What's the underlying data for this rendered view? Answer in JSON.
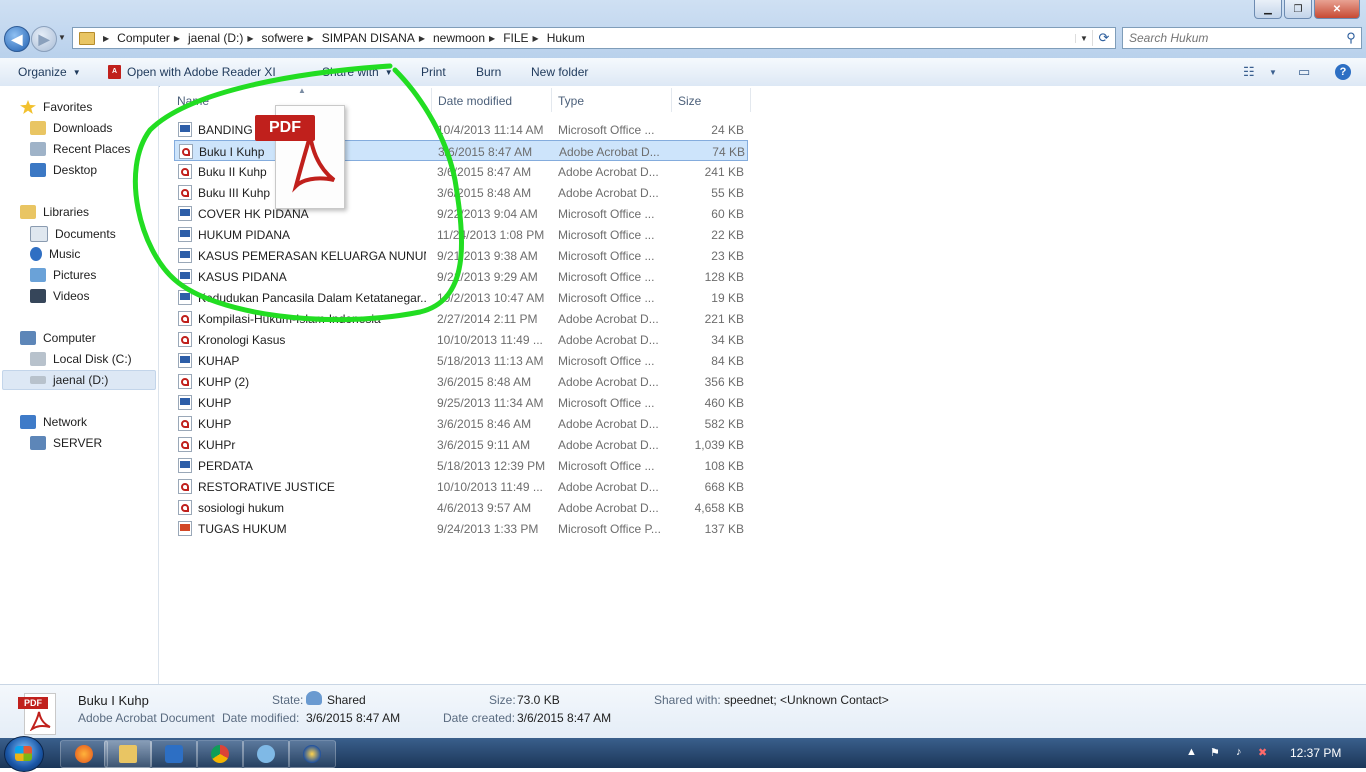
{
  "window": {
    "min_label": "▁",
    "max_label": "❐",
    "close_label": "✕"
  },
  "address": {
    "crumbs": [
      "Computer",
      "jaenal (D:)",
      "sofwere",
      "SIMPAN DISANA",
      "newmoon",
      "FILE",
      "Hukum"
    ]
  },
  "search": {
    "placeholder": "Search Hukum"
  },
  "toolbar": {
    "organize": "Organize",
    "open_with": "Open with Adobe Reader XI",
    "share_with": "Share with",
    "print": "Print",
    "burn": "Burn",
    "new_folder": "New folder"
  },
  "nav": {
    "favorites": "Favorites",
    "downloads": "Downloads",
    "recent": "Recent Places",
    "desktop": "Desktop",
    "libraries": "Libraries",
    "documents": "Documents",
    "music": "Music",
    "pictures": "Pictures",
    "videos": "Videos",
    "computer": "Computer",
    "local_disk": "Local Disk (C:)",
    "jaenal": "jaenal (D:)",
    "network": "Network",
    "server": "SERVER"
  },
  "columns": {
    "name": "Name",
    "date": "Date modified",
    "type": "Type",
    "size": "Size"
  },
  "files": [
    {
      "name": "BANDING DAN KASASI",
      "date": "10/4/2013 11:14 AM",
      "type": "Microsoft Office ...",
      "size": "24 KB",
      "icon": "doc"
    },
    {
      "name": "Buku I Kuhp",
      "date": "3/6/2015 8:47 AM",
      "type": "Adobe Acrobat D...",
      "size": "74 KB",
      "icon": "pdf",
      "selected": true
    },
    {
      "name": "Buku II Kuhp",
      "date": "3/6/2015 8:47 AM",
      "type": "Adobe Acrobat D...",
      "size": "241 KB",
      "icon": "pdf"
    },
    {
      "name": "Buku III Kuhp",
      "date": "3/6/2015 8:48 AM",
      "type": "Adobe Acrobat D...",
      "size": "55 KB",
      "icon": "pdf"
    },
    {
      "name": "COVER HK PIDANA",
      "date": "9/22/2013 9:04 AM",
      "type": "Microsoft Office ...",
      "size": "60 KB",
      "icon": "doc"
    },
    {
      "name": "HUKUM PIDANA",
      "date": "11/24/2013 1:08 PM",
      "type": "Microsoft Office ...",
      "size": "22 KB",
      "icon": "doc"
    },
    {
      "name": "KASUS  PEMERASAN KELUARGA NUNUNG",
      "date": "9/21/2013 9:38 AM",
      "type": "Microsoft Office ...",
      "size": "23 KB",
      "icon": "doc"
    },
    {
      "name": "KASUS PIDANA",
      "date": "9/21/2013 9:29 AM",
      "type": "Microsoft Office ...",
      "size": "128 KB",
      "icon": "doc"
    },
    {
      "name": "Kedudukan Pancasila Dalam Ketatanegar...",
      "date": "10/2/2013 10:47 AM",
      "type": "Microsoft Office ...",
      "size": "19 KB",
      "icon": "doc"
    },
    {
      "name": "Kompilasi-Hukum-Islam-Indonesia",
      "date": "2/27/2014 2:11 PM",
      "type": "Adobe Acrobat D...",
      "size": "221 KB",
      "icon": "pdf"
    },
    {
      "name": "Kronologi Kasus",
      "date": "10/10/2013 11:49 ...",
      "type": "Adobe Acrobat D...",
      "size": "34 KB",
      "icon": "pdf"
    },
    {
      "name": "KUHAP",
      "date": "5/18/2013 11:13 AM",
      "type": "Microsoft Office ...",
      "size": "84 KB",
      "icon": "doc"
    },
    {
      "name": "KUHP (2)",
      "date": "3/6/2015 8:48 AM",
      "type": "Adobe Acrobat D...",
      "size": "356 KB",
      "icon": "pdf"
    },
    {
      "name": "KUHP",
      "date": "9/25/2013 11:34 AM",
      "type": "Microsoft Office ...",
      "size": "460 KB",
      "icon": "doc"
    },
    {
      "name": "KUHP",
      "date": "3/6/2015 8:46 AM",
      "type": "Adobe Acrobat D...",
      "size": "582 KB",
      "icon": "pdf"
    },
    {
      "name": "KUHPr",
      "date": "3/6/2015 9:11 AM",
      "type": "Adobe Acrobat D...",
      "size": "1,039 KB",
      "icon": "pdf"
    },
    {
      "name": "PERDATA",
      "date": "5/18/2013 12:39 PM",
      "type": "Microsoft Office ...",
      "size": "108 KB",
      "icon": "doc"
    },
    {
      "name": "RESTORATIVE JUSTICE",
      "date": "10/10/2013 11:49 ...",
      "type": "Adobe Acrobat D...",
      "size": "668 KB",
      "icon": "pdf"
    },
    {
      "name": "sosiologi hukum",
      "date": "4/6/2013 9:57 AM",
      "type": "Adobe Acrobat D...",
      "size": "4,658 KB",
      "icon": "pdf"
    },
    {
      "name": "TUGAS HUKUM",
      "date": "9/24/2013 1:33 PM",
      "type": "Microsoft Office P...",
      "size": "137 KB",
      "icon": "ppt"
    }
  ],
  "drag_ghost": {
    "label": "PDF"
  },
  "details": {
    "title": "Buku I Kuhp",
    "subtitle": "Adobe Acrobat Document",
    "state_label": "State:",
    "state_value": "Shared",
    "modified_label": "Date modified:",
    "modified_value": "3/6/2015 8:47 AM",
    "size_label": "Size:",
    "size_value": "73.0 KB",
    "created_label": "Date created:",
    "created_value": "3/6/2015 8:47 AM",
    "shared_label": "Shared with:",
    "shared_value": "speednet; <Unknown Contact>"
  },
  "taskbar": {
    "clock": "12:37 PM"
  },
  "colors": {
    "selection": "#cde4fb",
    "annotation": "#22dd22",
    "pdf_red": "#c0201c",
    "doc_blue": "#2d5ea8"
  }
}
